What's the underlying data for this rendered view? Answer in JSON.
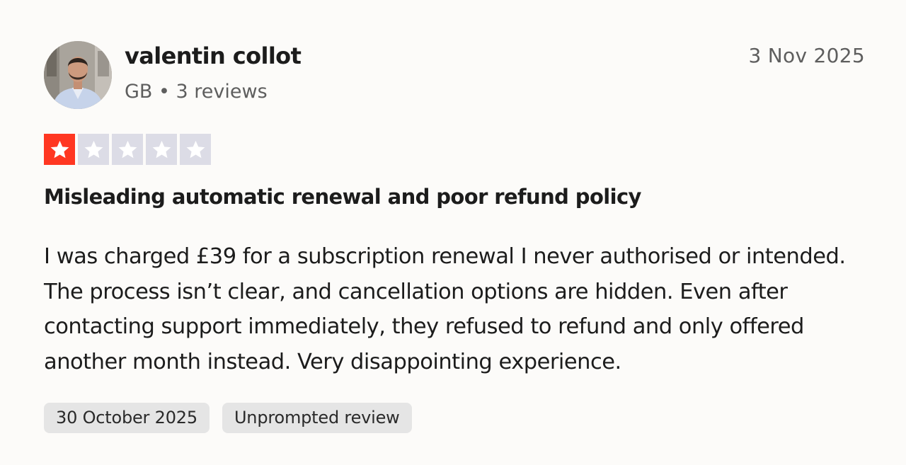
{
  "reviewer": {
    "name": "valentin collot",
    "meta": "GB • 3 reviews"
  },
  "review": {
    "date": "3 Nov 2025",
    "rating": 1,
    "rating_max": 5,
    "title": "Misleading automatic renewal and poor refund policy",
    "body": "I was charged £39 for a subscription renewal I never authorised or intended. The process isn’t clear, and cancellation options are hidden. Even after contacting support immediately, they refused to refund and only offered another month instead. Very disappointing experience.",
    "tags": [
      "30 October 2025",
      "Unprompted review"
    ]
  },
  "colors": {
    "star_on": "#ff3722",
    "star_off": "#dcdce6",
    "background": "#fcfbf9",
    "tag_bg": "#e5e5e5"
  },
  "icons": [
    "avatar-photo",
    "star-icon"
  ]
}
